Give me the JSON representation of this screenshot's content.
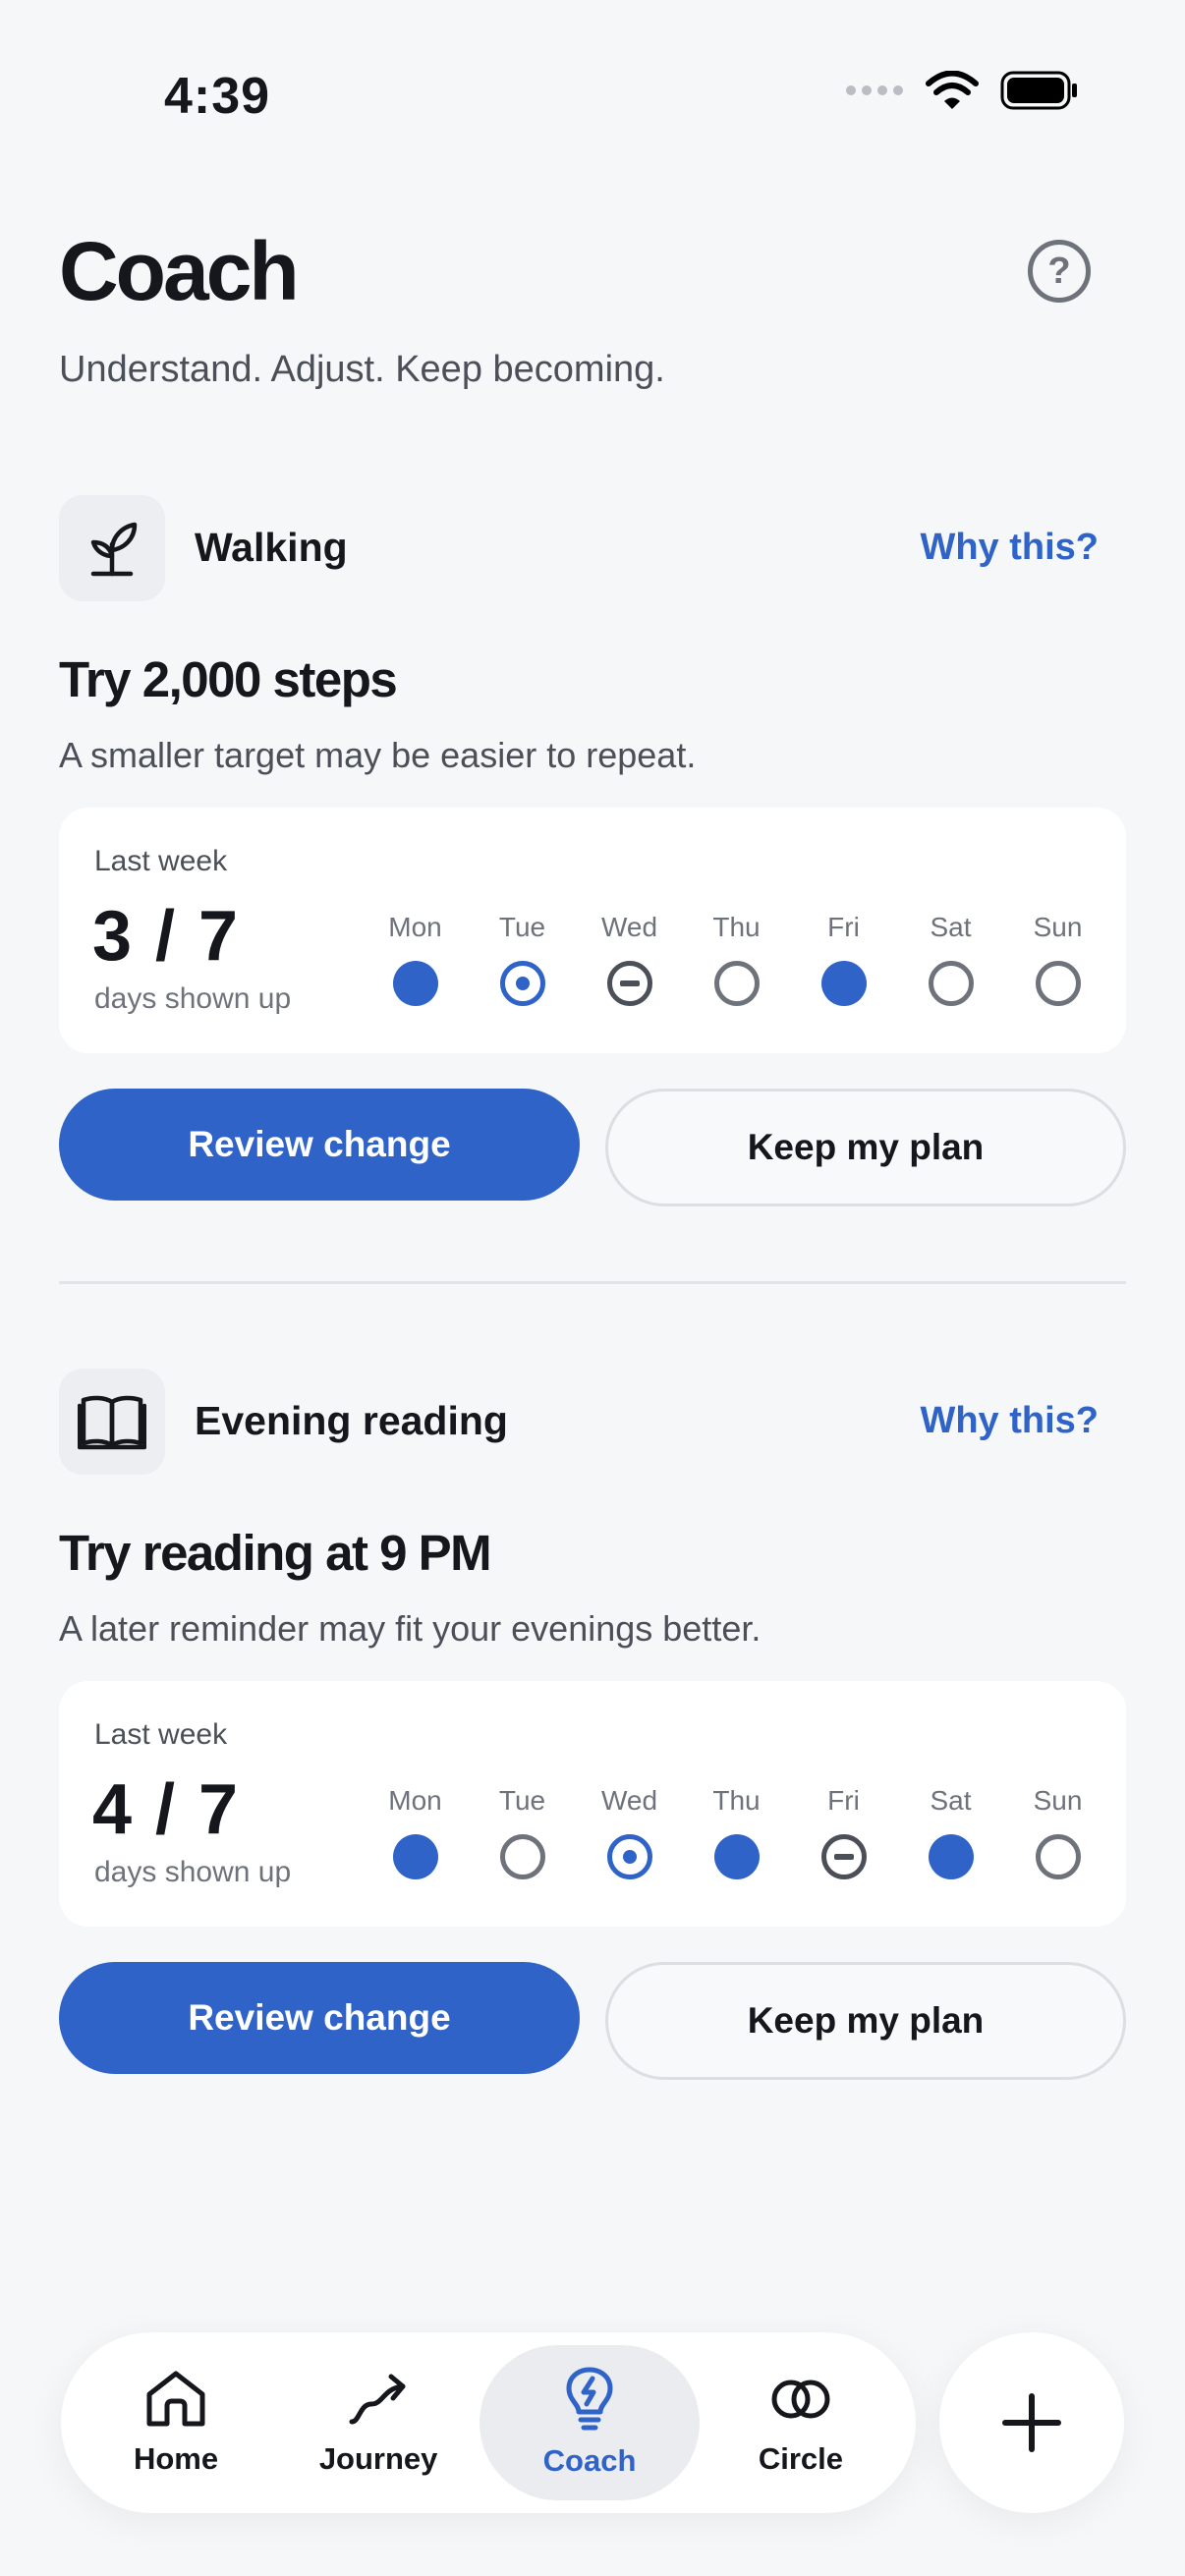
{
  "status": {
    "time": "4:39"
  },
  "header": {
    "title": "Coach",
    "subtitle": "Understand. Adjust. Keep becoming.",
    "help_label": "?"
  },
  "colors": {
    "accent": "#2f63c8",
    "background": "#f6f7f9"
  },
  "habits": [
    {
      "name": "Walking",
      "icon": "sprout-icon",
      "why_label": "Why this?",
      "suggestion": "Try 2,000 steps",
      "description": "A smaller target may be easier to repeat.",
      "week_label": "Last week",
      "count": "3 / 7",
      "count_caption": "days shown up",
      "days": [
        {
          "label": "Mon",
          "state": "done"
        },
        {
          "label": "Tue",
          "state": "today"
        },
        {
          "label": "Wed",
          "state": "skip"
        },
        {
          "label": "Thu",
          "state": "open"
        },
        {
          "label": "Fri",
          "state": "done"
        },
        {
          "label": "Sat",
          "state": "open"
        },
        {
          "label": "Sun",
          "state": "open"
        }
      ],
      "primary_label": "Review change",
      "secondary_label": "Keep my plan"
    },
    {
      "name": "Evening reading",
      "icon": "book-icon",
      "why_label": "Why this?",
      "suggestion": "Try reading at 9 PM",
      "description": "A later reminder may fit your evenings better.",
      "week_label": "Last week",
      "count": "4 / 7",
      "count_caption": "days shown up",
      "days": [
        {
          "label": "Mon",
          "state": "done"
        },
        {
          "label": "Tue",
          "state": "open"
        },
        {
          "label": "Wed",
          "state": "today"
        },
        {
          "label": "Thu",
          "state": "done"
        },
        {
          "label": "Fri",
          "state": "skip"
        },
        {
          "label": "Sat",
          "state": "done"
        },
        {
          "label": "Sun",
          "state": "open"
        }
      ],
      "primary_label": "Review change",
      "secondary_label": "Keep my plan"
    }
  ],
  "nav": {
    "items": [
      {
        "label": "Home",
        "icon": "home-icon"
      },
      {
        "label": "Journey",
        "icon": "journey-arrow-icon"
      },
      {
        "label": "Coach",
        "icon": "lightbulb-icon",
        "active": true
      },
      {
        "label": "Circle",
        "icon": "circle-rings-icon"
      }
    ],
    "add_icon": "plus-icon"
  }
}
